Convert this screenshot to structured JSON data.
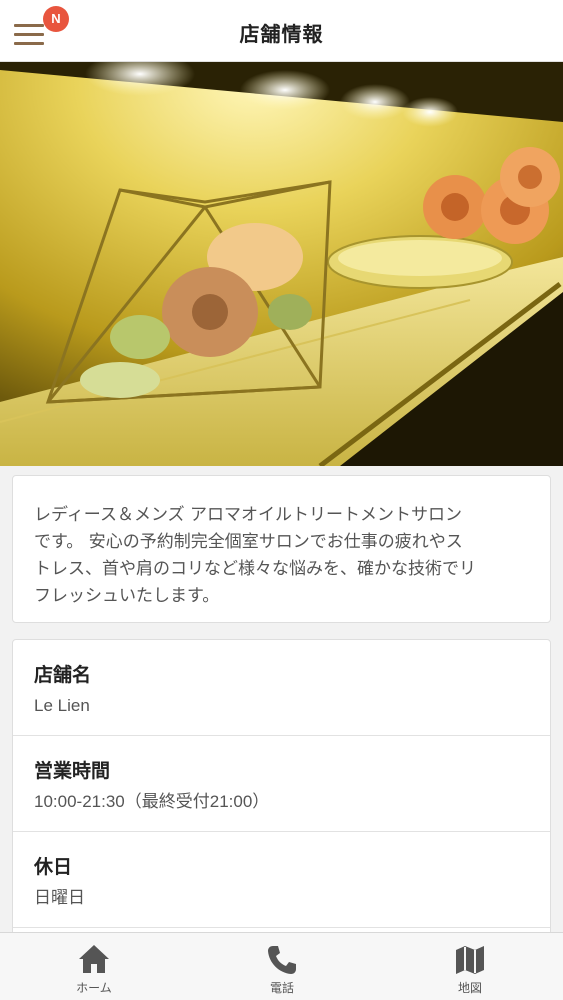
{
  "header": {
    "title": "店舗情報",
    "notification_badge": "N",
    "menu_icon": "hamburger-icon",
    "menu_color": "#8a6a4a",
    "badge_color": "#e8553e"
  },
  "hero": {
    "alt_icon": "shop-photo"
  },
  "description": {
    "lines": [
      "レディース＆メンズ アロマオイルトリートメントサロン",
      "です。 安心の予約制完全個室サロンでお仕事の疲れやス",
      "トレス、首や肩のコリなど様々な悩みを、確かな技術でリ",
      "フレッシュいたします。"
    ]
  },
  "info": [
    {
      "label": "店舗名",
      "value": "Le Lien"
    },
    {
      "label": "営業時間",
      "value": "10:00-21:30（最終受付21:00）"
    },
    {
      "label": "休日",
      "value": "日曜日"
    }
  ],
  "bottom_nav": [
    {
      "label": "ホーム",
      "icon": "home-icon"
    },
    {
      "label": "電話",
      "icon": "phone-icon"
    },
    {
      "label": "地図",
      "icon": "map-icon"
    }
  ]
}
